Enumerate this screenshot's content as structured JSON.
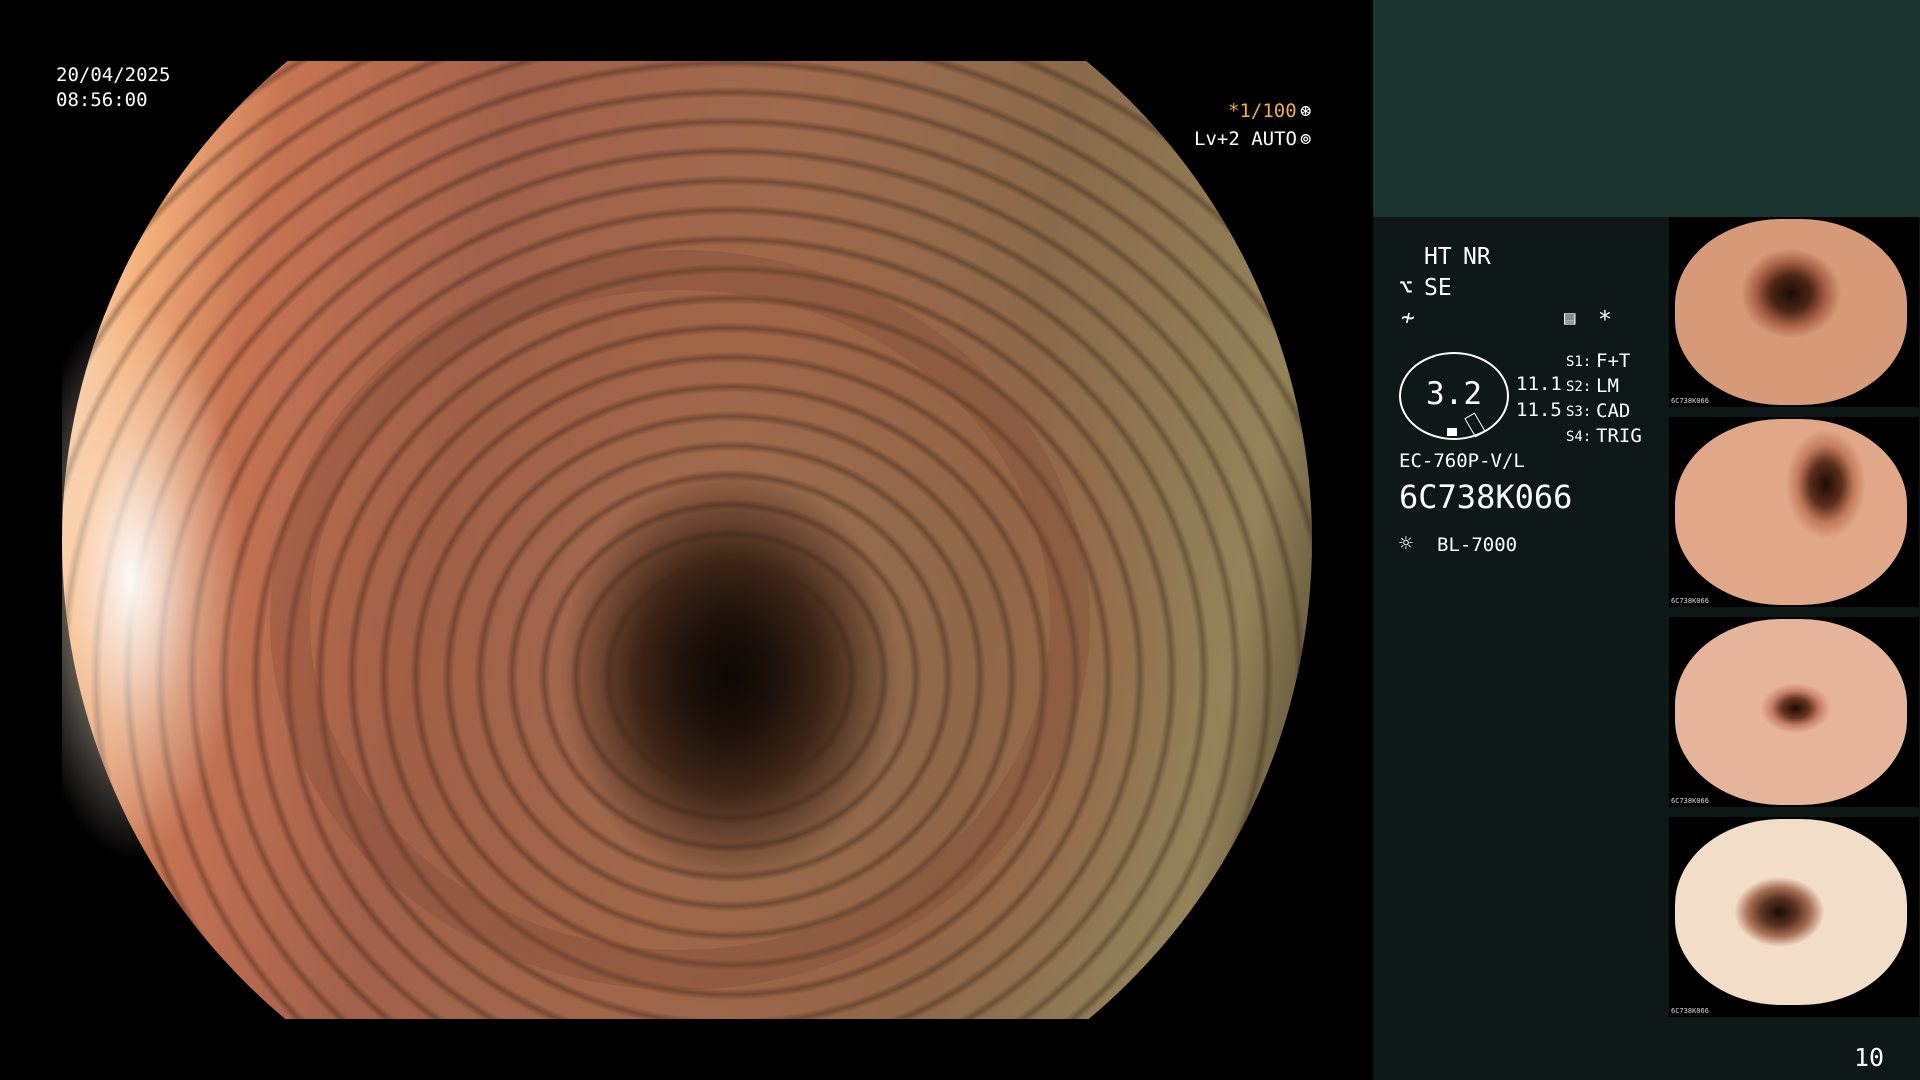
{
  "overlay": {
    "date": "20/04/2025",
    "time": "08:56:00",
    "shutter": "*1/100",
    "shutter_icon": "aperture-icon",
    "level": "Lv+2 AUTO",
    "level_icon": "iris-icon"
  },
  "panel": {
    "mode_ht": "HT",
    "mode_nr": "NR",
    "mode_se": "SE",
    "mode_se_icon": "structure-enhance-icon",
    "mode_freq_icon": "frequency-icon",
    "stack_icon": "image-stack-icon",
    "asterisk": "*",
    "gauge_value": "3.2",
    "reading_1": "11.1",
    "reading_2": "11.5",
    "switches": [
      {
        "key": "S1:",
        "value": "F+T"
      },
      {
        "key": "S2:",
        "value": "LM"
      },
      {
        "key": "S3:",
        "value": "CAD"
      },
      {
        "key": "S4:",
        "value": "TRIG"
      }
    ],
    "scope_model": "EC-760P-V/L",
    "serial": "6C738K066",
    "light_icon": "light-source-icon",
    "light_source": "BL-7000",
    "count": "10"
  },
  "thumbnails": [
    {
      "caption": "6C738K066"
    },
    {
      "caption": "6C738K066"
    },
    {
      "caption": "6C738K066"
    },
    {
      "caption": "6C738K066"
    }
  ],
  "colors": {
    "accent": "#f0b030",
    "panel_top": "#1a3530",
    "panel_bg": "#0d1817"
  }
}
